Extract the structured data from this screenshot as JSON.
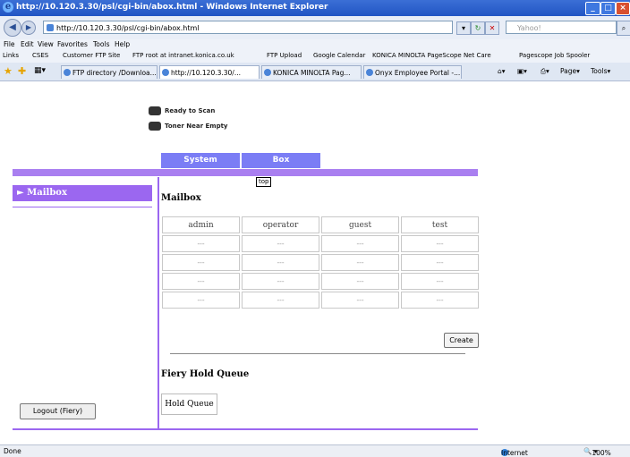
{
  "window": {
    "title": "http://10.120.3.30/psl/cgi-bin/abox.html - Windows Internet Explorer"
  },
  "address": {
    "url": "http://10.120.3.30/psl/cgi-bin/abox.html",
    "search_placeholder": "Yahoo!"
  },
  "menu": [
    "File",
    "Edit",
    "View",
    "Favorites",
    "Tools",
    "Help"
  ],
  "links": {
    "label": "Links",
    "items": [
      "CSES",
      "Customer FTP Site",
      "FTP root at intranet.konica.co.uk",
      "FTP Upload",
      "Google Calendar",
      "KONICA MINOLTA PageScope Net Care",
      "Pagescope Job Spooler"
    ]
  },
  "tabs": [
    "FTP directory /Downloa...",
    "http://10.120.3.30/...",
    "KONICA MINOLTA Pag...",
    "Onyx Employee Portal -..."
  ],
  "tab_tools": {
    "page": "Page",
    "tools": "Tools"
  },
  "device_status": {
    "scan": "Ready to Scan",
    "toner": "Toner Near Empty"
  },
  "nav": {
    "system": "System",
    "box": "Box"
  },
  "tooltip": "top",
  "sidebar": {
    "mailbox": "Mailbox",
    "logout": "Logout (Fiery)"
  },
  "main": {
    "heading": "Mailbox",
    "columns": [
      "admin",
      "operator",
      "guest",
      "test"
    ],
    "empty_cell": "---",
    "create": "Create",
    "fiery_heading": "Fiery Hold Queue",
    "hold_queue": "Hold Queue"
  },
  "statusbar": {
    "left": "Done",
    "zone": "Internet",
    "zoom": "100%"
  },
  "colors": {
    "accent": "#9b67f0",
    "nav": "#7b7df5",
    "titlebar": "#2155c4"
  }
}
